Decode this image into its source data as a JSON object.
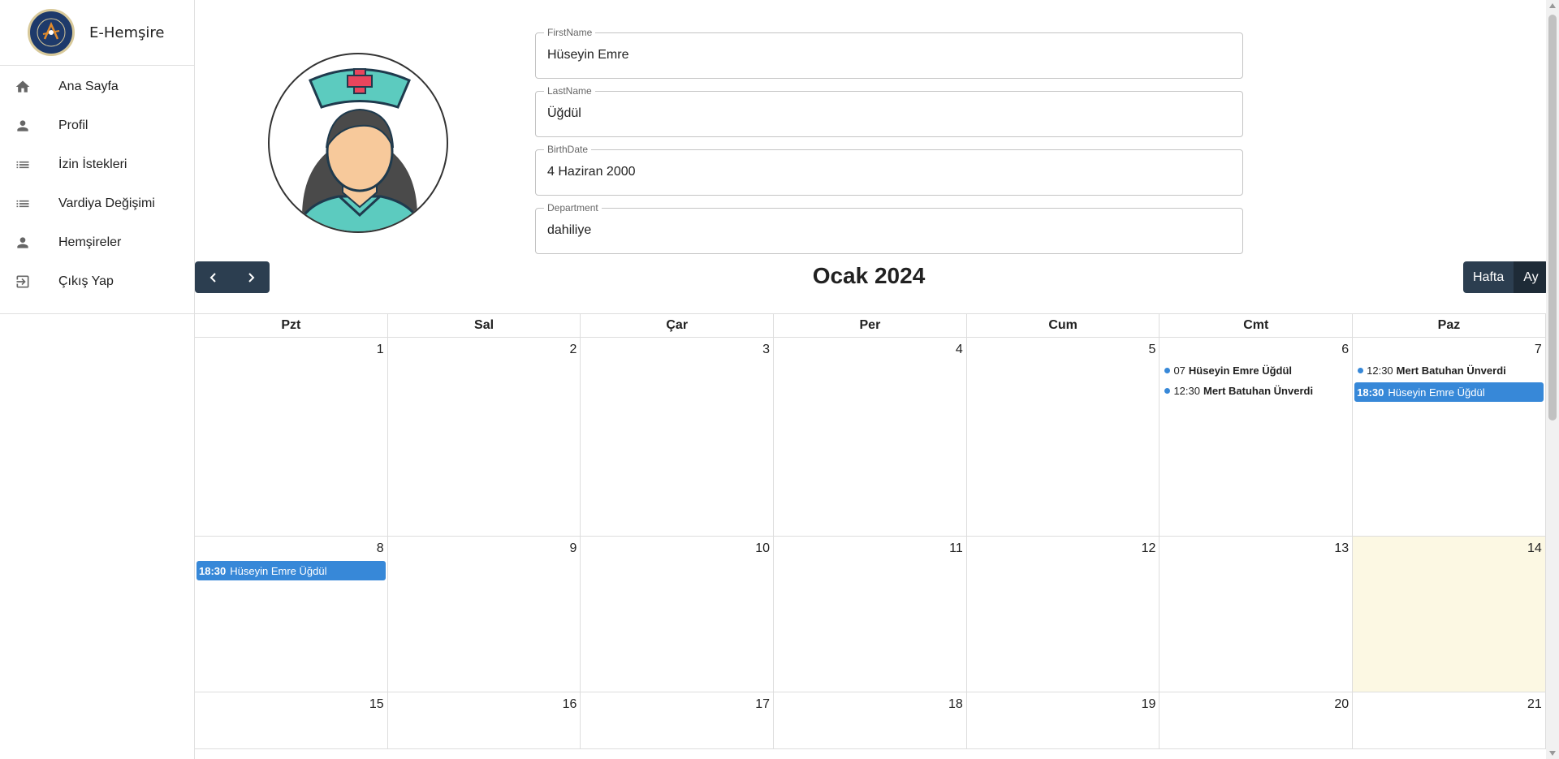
{
  "app": {
    "title": "E-Hemşire"
  },
  "sidebar": {
    "items": [
      {
        "label": "Ana Sayfa",
        "icon": "home-icon"
      },
      {
        "label": "Profil",
        "icon": "person-icon"
      },
      {
        "label": "İzin İstekleri",
        "icon": "list-icon"
      },
      {
        "label": "Vardiya Değişimi",
        "icon": "list-icon"
      },
      {
        "label": "Hemşireler",
        "icon": "person-icon"
      },
      {
        "label": "Çıkış Yap",
        "icon": "logout-icon"
      }
    ]
  },
  "profile": {
    "fields": [
      {
        "label": "FirstName",
        "value": "Hüseyin Emre"
      },
      {
        "label": "LastName",
        "value": "Üğdül"
      },
      {
        "label": "BirthDate",
        "value": "4 Haziran 2000"
      },
      {
        "label": "Department",
        "value": "dahiliye"
      }
    ]
  },
  "calendar": {
    "title": "Ocak 2024",
    "views": [
      "Hafta",
      "Ay"
    ],
    "active_view": "Ay",
    "day_headers": [
      "Pzt",
      "Sal",
      "Çar",
      "Per",
      "Cum",
      "Cmt",
      "Paz"
    ],
    "weeks": [
      {
        "days": [
          {
            "num": "1",
            "events": []
          },
          {
            "num": "2",
            "events": []
          },
          {
            "num": "3",
            "events": []
          },
          {
            "num": "4",
            "events": []
          },
          {
            "num": "5",
            "events": []
          },
          {
            "num": "6",
            "events": [
              {
                "style": "dot",
                "time": "07",
                "title": "Hüseyin Emre Üğdül"
              },
              {
                "style": "dot",
                "time": "12:30",
                "title": "Mert Batuhan Ünverdi"
              }
            ]
          },
          {
            "num": "7",
            "events": [
              {
                "style": "dot",
                "time": "12:30",
                "title": "Mert Batuhan Ünverdi"
              },
              {
                "style": "block",
                "time": "18:30",
                "title": "Hüseyin Emre Üğdül"
              }
            ]
          }
        ]
      },
      {
        "days": [
          {
            "num": "8",
            "events": [
              {
                "style": "block",
                "time": "18:30",
                "title": "Hüseyin Emre Üğdül"
              }
            ]
          },
          {
            "num": "9",
            "events": []
          },
          {
            "num": "10",
            "events": []
          },
          {
            "num": "11",
            "events": []
          },
          {
            "num": "12",
            "events": []
          },
          {
            "num": "13",
            "events": []
          },
          {
            "num": "14",
            "events": [],
            "today": true
          }
        ]
      },
      {
        "days": [
          {
            "num": "15",
            "events": []
          },
          {
            "num": "16",
            "events": []
          },
          {
            "num": "17",
            "events": []
          },
          {
            "num": "18",
            "events": []
          },
          {
            "num": "19",
            "events": []
          },
          {
            "num": "20",
            "events": []
          },
          {
            "num": "21",
            "events": []
          }
        ]
      }
    ]
  },
  "colors": {
    "event": "#3788d8",
    "toolbar": "#2c3e50",
    "today": "#fcf8e3"
  }
}
